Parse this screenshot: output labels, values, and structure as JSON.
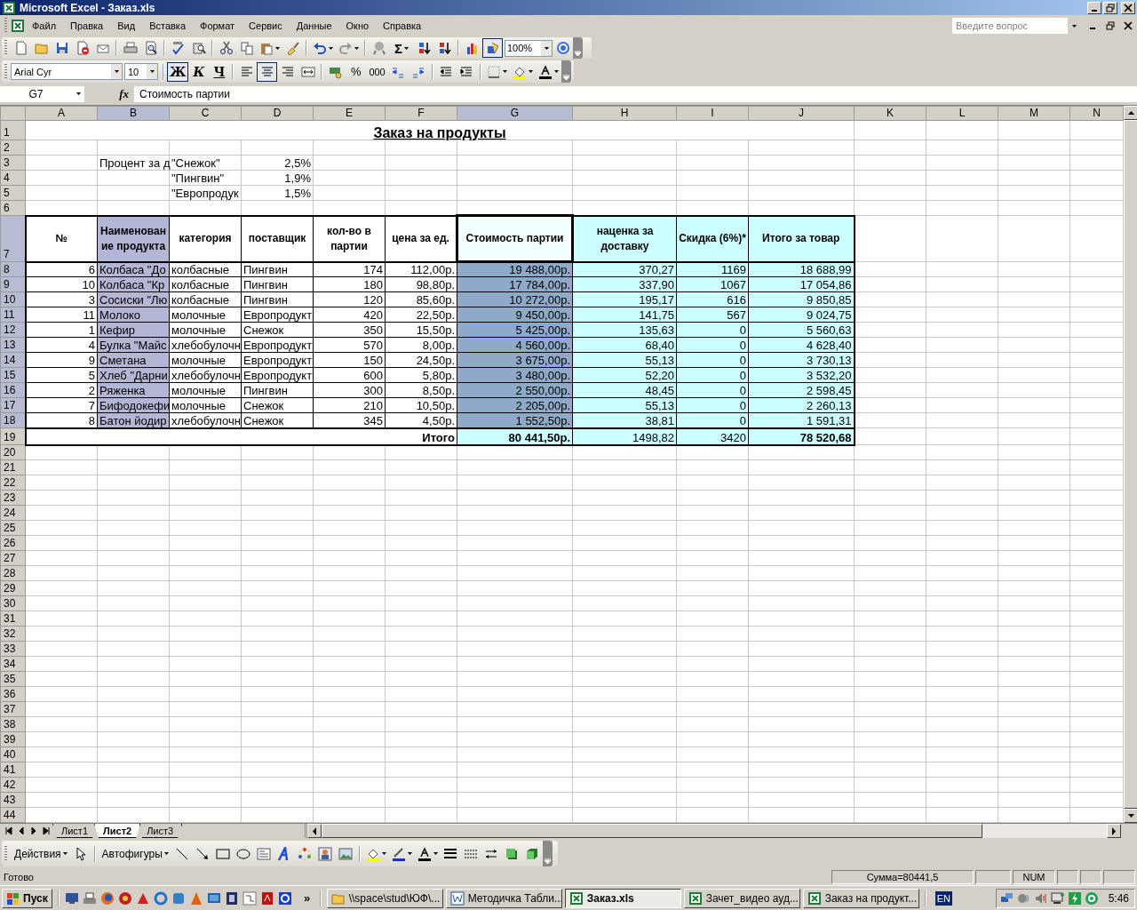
{
  "window": {
    "title": "Microsoft Excel - Заказ.xls"
  },
  "menu": {
    "items": [
      "Файл",
      "Правка",
      "Вид",
      "Вставка",
      "Формат",
      "Сервис",
      "Данные",
      "Окно",
      "Справка"
    ],
    "question": {
      "placeholder": "Введите вопрос"
    }
  },
  "standard_toolbar": {
    "sum": "Σ",
    "zoom": "100%",
    "drawing_selected": true
  },
  "format_toolbar": {
    "font": "Arial Cyr",
    "size": "10",
    "styles": [
      {
        "label": "Ж",
        "selected": true
      },
      {
        "label": "К",
        "selected": false
      },
      {
        "label": "Ч",
        "selected": false
      }
    ],
    "alignment": [
      {
        "selected": false
      },
      {
        "selected": true
      },
      {
        "selected": false
      }
    ],
    "percent": "%",
    "thousands": "000"
  },
  "formula_bar": {
    "name_box": "G7",
    "function_label": "fx",
    "formula": "Стоимость партии"
  },
  "sheet": {
    "columns": [
      {
        "label": "A",
        "selected": false
      },
      {
        "label": "B",
        "selected": true
      },
      {
        "label": "C",
        "selected": false
      },
      {
        "label": "D",
        "selected": false
      },
      {
        "label": "E",
        "selected": false
      },
      {
        "label": "F",
        "selected": false
      },
      {
        "label": "G",
        "selected": true
      },
      {
        "label": "H",
        "selected": false
      },
      {
        "label": "I",
        "selected": false
      },
      {
        "label": "J",
        "selected": false
      },
      {
        "label": "K",
        "selected": false
      },
      {
        "label": "L",
        "selected": false
      },
      {
        "label": "M",
        "selected": false
      },
      {
        "label": "N",
        "selected": false
      }
    ],
    "rows": [
      {
        "number": "1",
        "kind": "title",
        "selected": false,
        "text": "Заказ на продукты"
      },
      {
        "number": "2",
        "kind": "blank",
        "selected": false
      },
      {
        "number": "3",
        "kind": "rate",
        "selected": false,
        "label": "Процент за д",
        "supplier": "\"Снежок\"",
        "rate": "2,5%"
      },
      {
        "number": "4",
        "kind": "rate",
        "selected": false,
        "supplier": "\"Пингвин\"",
        "rate": "1,9%"
      },
      {
        "number": "5",
        "kind": "rate",
        "selected": false,
        "supplier": "\"Европродук",
        "rate": "1,5%"
      },
      {
        "number": "6",
        "kind": "blank",
        "selected": false
      },
      {
        "number": "7",
        "kind": "header",
        "selected": true,
        "cells": [
          {
            "text": "№",
            "active": false
          },
          {
            "text": "Наименование продукта",
            "active": false
          },
          {
            "text": "категория",
            "active": false
          },
          {
            "text": "поставщик",
            "active": false
          },
          {
            "text": "кол-во в партии",
            "active": false
          },
          {
            "text": "цена за ед.",
            "active": false
          },
          {
            "text": "Стоимость партии",
            "active": true
          },
          {
            "text": "наценка за доставку",
            "active": false
          },
          {
            "text": "Скидка (6%)*",
            "active": false
          },
          {
            "text": "Итого за товар",
            "active": false
          }
        ]
      },
      {
        "number": "8",
        "kind": "data",
        "selected": true,
        "cells": [
          "6",
          "Колбаса \"До",
          "колбасные",
          "Пингвин",
          "174",
          "112,00р.",
          "19 488,00р.",
          "370,27",
          "1169",
          "18 688,99"
        ]
      },
      {
        "number": "9",
        "kind": "data",
        "selected": true,
        "cells": [
          "10",
          "Колбаса \"Кр",
          "колбасные",
          "Пингвин",
          "180",
          "98,80р.",
          "17 784,00р.",
          "337,90",
          "1067",
          "17 054,86"
        ]
      },
      {
        "number": "10",
        "kind": "data",
        "selected": true,
        "cells": [
          "3",
          "Сосиски \"Лю",
          "колбасные",
          "Пингвин",
          "120",
          "85,60р.",
          "10 272,00р.",
          "195,17",
          "616",
          "9 850,85"
        ]
      },
      {
        "number": "11",
        "kind": "data",
        "selected": true,
        "cells": [
          "11",
          "Молоко",
          "молочные",
          "Европродукт",
          "420",
          "22,50р.",
          "9 450,00р.",
          "141,75",
          "567",
          "9 024,75"
        ]
      },
      {
        "number": "12",
        "kind": "data",
        "selected": true,
        "cells": [
          "1",
          "Кефир",
          "молочные",
          "Снежок",
          "350",
          "15,50р.",
          "5 425,00р.",
          "135,63",
          "0",
          "5 560,63"
        ]
      },
      {
        "number": "13",
        "kind": "data",
        "selected": true,
        "cells": [
          "4",
          "Булка \"Майс",
          "хлебобулочн",
          "Европродукт",
          "570",
          "8,00р.",
          "4 560,00р.",
          "68,40",
          "0",
          "4 628,40"
        ]
      },
      {
        "number": "14",
        "kind": "data",
        "selected": true,
        "cells": [
          "9",
          "Сметана",
          "молочные",
          "Европродукт",
          "150",
          "24,50р.",
          "3 675,00р.",
          "55,13",
          "0",
          "3 730,13"
        ]
      },
      {
        "number": "15",
        "kind": "data",
        "selected": true,
        "cells": [
          "5",
          "Хлеб \"Дарни",
          "хлебобулочн",
          "Европродукт",
          "600",
          "5,80р.",
          "3 480,00р.",
          "52,20",
          "0",
          "3 532,20"
        ]
      },
      {
        "number": "16",
        "kind": "data",
        "selected": true,
        "cells": [
          "2",
          "Ряженка",
          "молочные",
          "Пингвин",
          "300",
          "8,50р.",
          "2 550,00р.",
          "48,45",
          "0",
          "2 598,45"
        ]
      },
      {
        "number": "17",
        "kind": "data",
        "selected": true,
        "cells": [
          "7",
          "Бифодокефи",
          "молочные",
          "Снежок",
          "210",
          "10,50р.",
          "2 205,00р.",
          "55,13",
          "0",
          "2 260,13"
        ]
      },
      {
        "number": "18",
        "kind": "data",
        "selected": true,
        "cells": [
          "8",
          "Батон йодир",
          "хлебобулочн",
          "Снежок",
          "345",
          "4,50р.",
          "1 552,50р.",
          "38,81",
          "0",
          "1 591,31"
        ]
      },
      {
        "number": "19",
        "kind": "total",
        "selected": false,
        "label": "Итого",
        "cells": [
          "80 441,50р.",
          "1498,82",
          "3420",
          "78 520,68"
        ]
      },
      {
        "number": "20",
        "kind": "blank",
        "selected": false
      },
      {
        "number": "21",
        "kind": "blank",
        "selected": false
      },
      {
        "number": "22",
        "kind": "blank",
        "selected": false
      },
      {
        "number": "23",
        "kind": "blank",
        "selected": false
      },
      {
        "number": "24",
        "kind": "blank",
        "selected": false
      },
      {
        "number": "25",
        "kind": "blank",
        "selected": false
      },
      {
        "number": "26",
        "kind": "blank",
        "selected": false
      },
      {
        "number": "27",
        "kind": "blank",
        "selected": false
      },
      {
        "number": "28",
        "kind": "blank",
        "selected": false
      },
      {
        "number": "29",
        "kind": "blank",
        "selected": false
      },
      {
        "number": "30",
        "kind": "blank",
        "selected": false
      },
      {
        "number": "31",
        "kind": "blank",
        "selected": false
      },
      {
        "number": "32",
        "kind": "blank",
        "selected": false
      },
      {
        "number": "33",
        "kind": "blank",
        "selected": false
      },
      {
        "number": "34",
        "kind": "blank",
        "selected": false
      },
      {
        "number": "35",
        "kind": "blank",
        "selected": false
      },
      {
        "number": "36",
        "kind": "blank",
        "selected": false
      },
      {
        "number": "37",
        "kind": "blank",
        "selected": false
      },
      {
        "number": "38",
        "kind": "blank",
        "selected": false
      },
      {
        "number": "39",
        "kind": "blank",
        "selected": false
      },
      {
        "number": "40",
        "kind": "blank",
        "selected": false
      },
      {
        "number": "41",
        "kind": "blank",
        "selected": false
      },
      {
        "number": "42",
        "kind": "blank",
        "selected": false
      },
      {
        "number": "43",
        "kind": "blank",
        "selected": false
      },
      {
        "number": "44",
        "kind": "blank",
        "selected": false
      }
    ]
  },
  "sheet_tabs": [
    {
      "label": "Лист1",
      "selected": false
    },
    {
      "label": "Лист2",
      "selected": true
    },
    {
      "label": "Лист3",
      "selected": false
    }
  ],
  "drawing_toolbar": {
    "actions": "Действия",
    "autoshapes": "Автофигуры"
  },
  "status_bar": {
    "status": "Готово",
    "sum": "Сумма=80441,5",
    "num_lock": "NUM"
  },
  "taskbar": {
    "start": "Пуск",
    "more": "»",
    "tasks": [
      {
        "label": "\\\\space\\stud\\ЮФ\\...",
        "kind": "folder",
        "selected": false
      },
      {
        "label": "Методичка Табли...",
        "kind": "word",
        "selected": false
      },
      {
        "label": "Заказ.xls",
        "kind": "excel",
        "selected": true
      },
      {
        "label": "Зачет_видео ауд...",
        "kind": "excel",
        "selected": false
      },
      {
        "label": "Заказ на продукт...",
        "kind": "excel",
        "selected": false
      }
    ],
    "language": "EN",
    "clock": "5:46"
  }
}
